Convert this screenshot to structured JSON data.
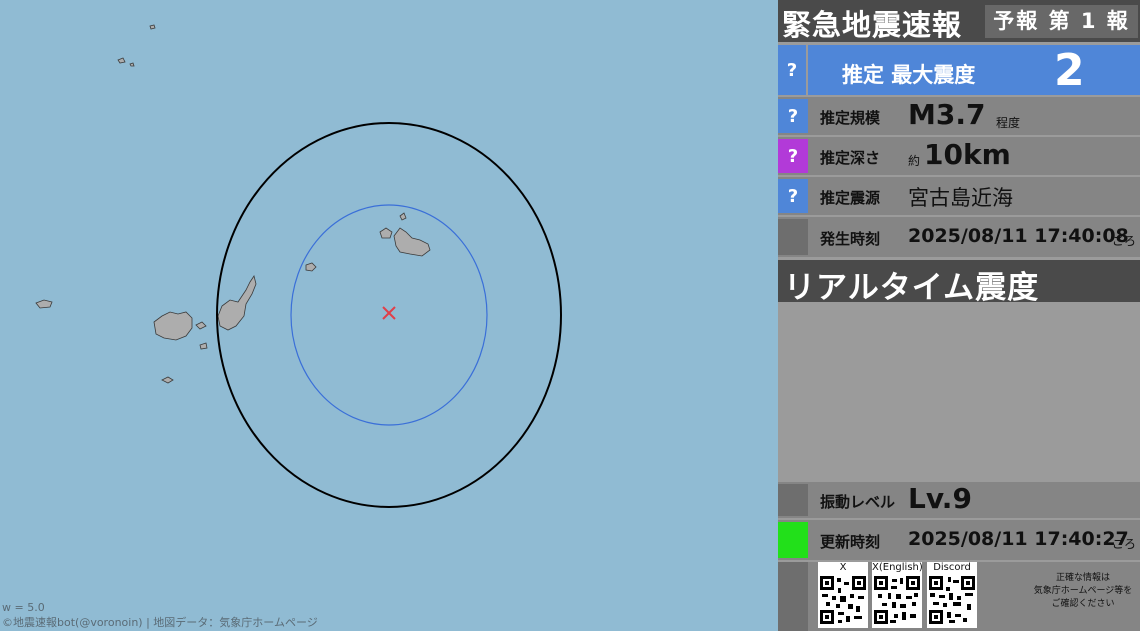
{
  "map": {
    "scale_caption": "w = 5.0",
    "credit": "©地震速報bot(@voronoin) | 地図データ：気象庁ホームページ",
    "colors": {
      "sea": "#90bbd3",
      "land": "#adadad",
      "outer_ring": "#000000",
      "inner_ring": "#3a6fd8",
      "epicenter": "#e0404a"
    }
  },
  "header": {
    "title": "緊急地震速報",
    "report": "予報 第 1 報"
  },
  "intensity": {
    "badge": "?",
    "label": "推定 最大震度",
    "value": "2",
    "color": "#4f86d8"
  },
  "magnitude": {
    "badge": "?",
    "badge_color": "#4f86d8",
    "label": "推定規模",
    "value": "M3.7",
    "suffix": "程度"
  },
  "depth": {
    "badge": "?",
    "badge_color": "#b23ad8",
    "label": "推定深さ",
    "prefix": "約",
    "value": "10km"
  },
  "epicenter": {
    "badge": "?",
    "badge_color": "#4f86d8",
    "label": "推定震源",
    "value": "宮古島近海"
  },
  "origin_time": {
    "label": "発生時刻",
    "value": "2025/08/11 17:40:08",
    "suffix": "ごろ"
  },
  "realtime": {
    "title": "リアルタイム震度"
  },
  "level": {
    "label": "振動レベル",
    "value": "Lv.9"
  },
  "update_time": {
    "status_color": "#22e01a",
    "label": "更新時刻",
    "value": "2025/08/11 17:40:27",
    "suffix": "ごろ"
  },
  "links": {
    "qr": [
      {
        "label": "X"
      },
      {
        "label": "X(English)"
      },
      {
        "label": "Discord"
      }
    ],
    "note_line1": "正確な情報は",
    "note_line2": "気象庁ホームページ等を",
    "note_line3": "ご確認ください"
  }
}
